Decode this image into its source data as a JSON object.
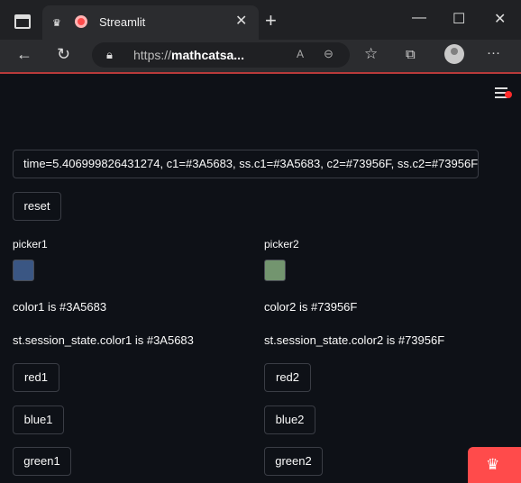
{
  "browser": {
    "tab_title": "Streamlit",
    "url_scheme": "https://",
    "url_host": "mathcatsa...",
    "controls": {
      "minimize": "—",
      "maximize": "☐",
      "close": "✕",
      "back": "←",
      "refresh": "↻",
      "new_tab": "+",
      "more": "···"
    }
  },
  "app": {
    "info_text": "time=5.406999826431274, c1=#3A5683, ss.c1=#3A5683, c2=#73956F, ss.c2=#73956F",
    "reset_label": "reset",
    "left": {
      "picker_label": "picker1",
      "swatch_color": "#3A5683",
      "color_text": "color1 is #3A5683",
      "state_text": "st.session_state.color1 is #3A5683",
      "buttons": [
        "red1",
        "blue1",
        "green1"
      ]
    },
    "right": {
      "picker_label": "picker2",
      "swatch_color": "#73956F",
      "color_text": "color2 is #73956F",
      "state_text": "st.session_state.color2 is #73956F",
      "buttons": [
        "red2",
        "blue2",
        "green2"
      ]
    }
  },
  "icons": {
    "tab_crown": "♛",
    "tab_close": "✕",
    "lock": "🔒︎",
    "read_aloud": "A",
    "zoom": "⊖",
    "favorites": "☆",
    "collections": "⧉",
    "streamlit_badge": "♛"
  }
}
